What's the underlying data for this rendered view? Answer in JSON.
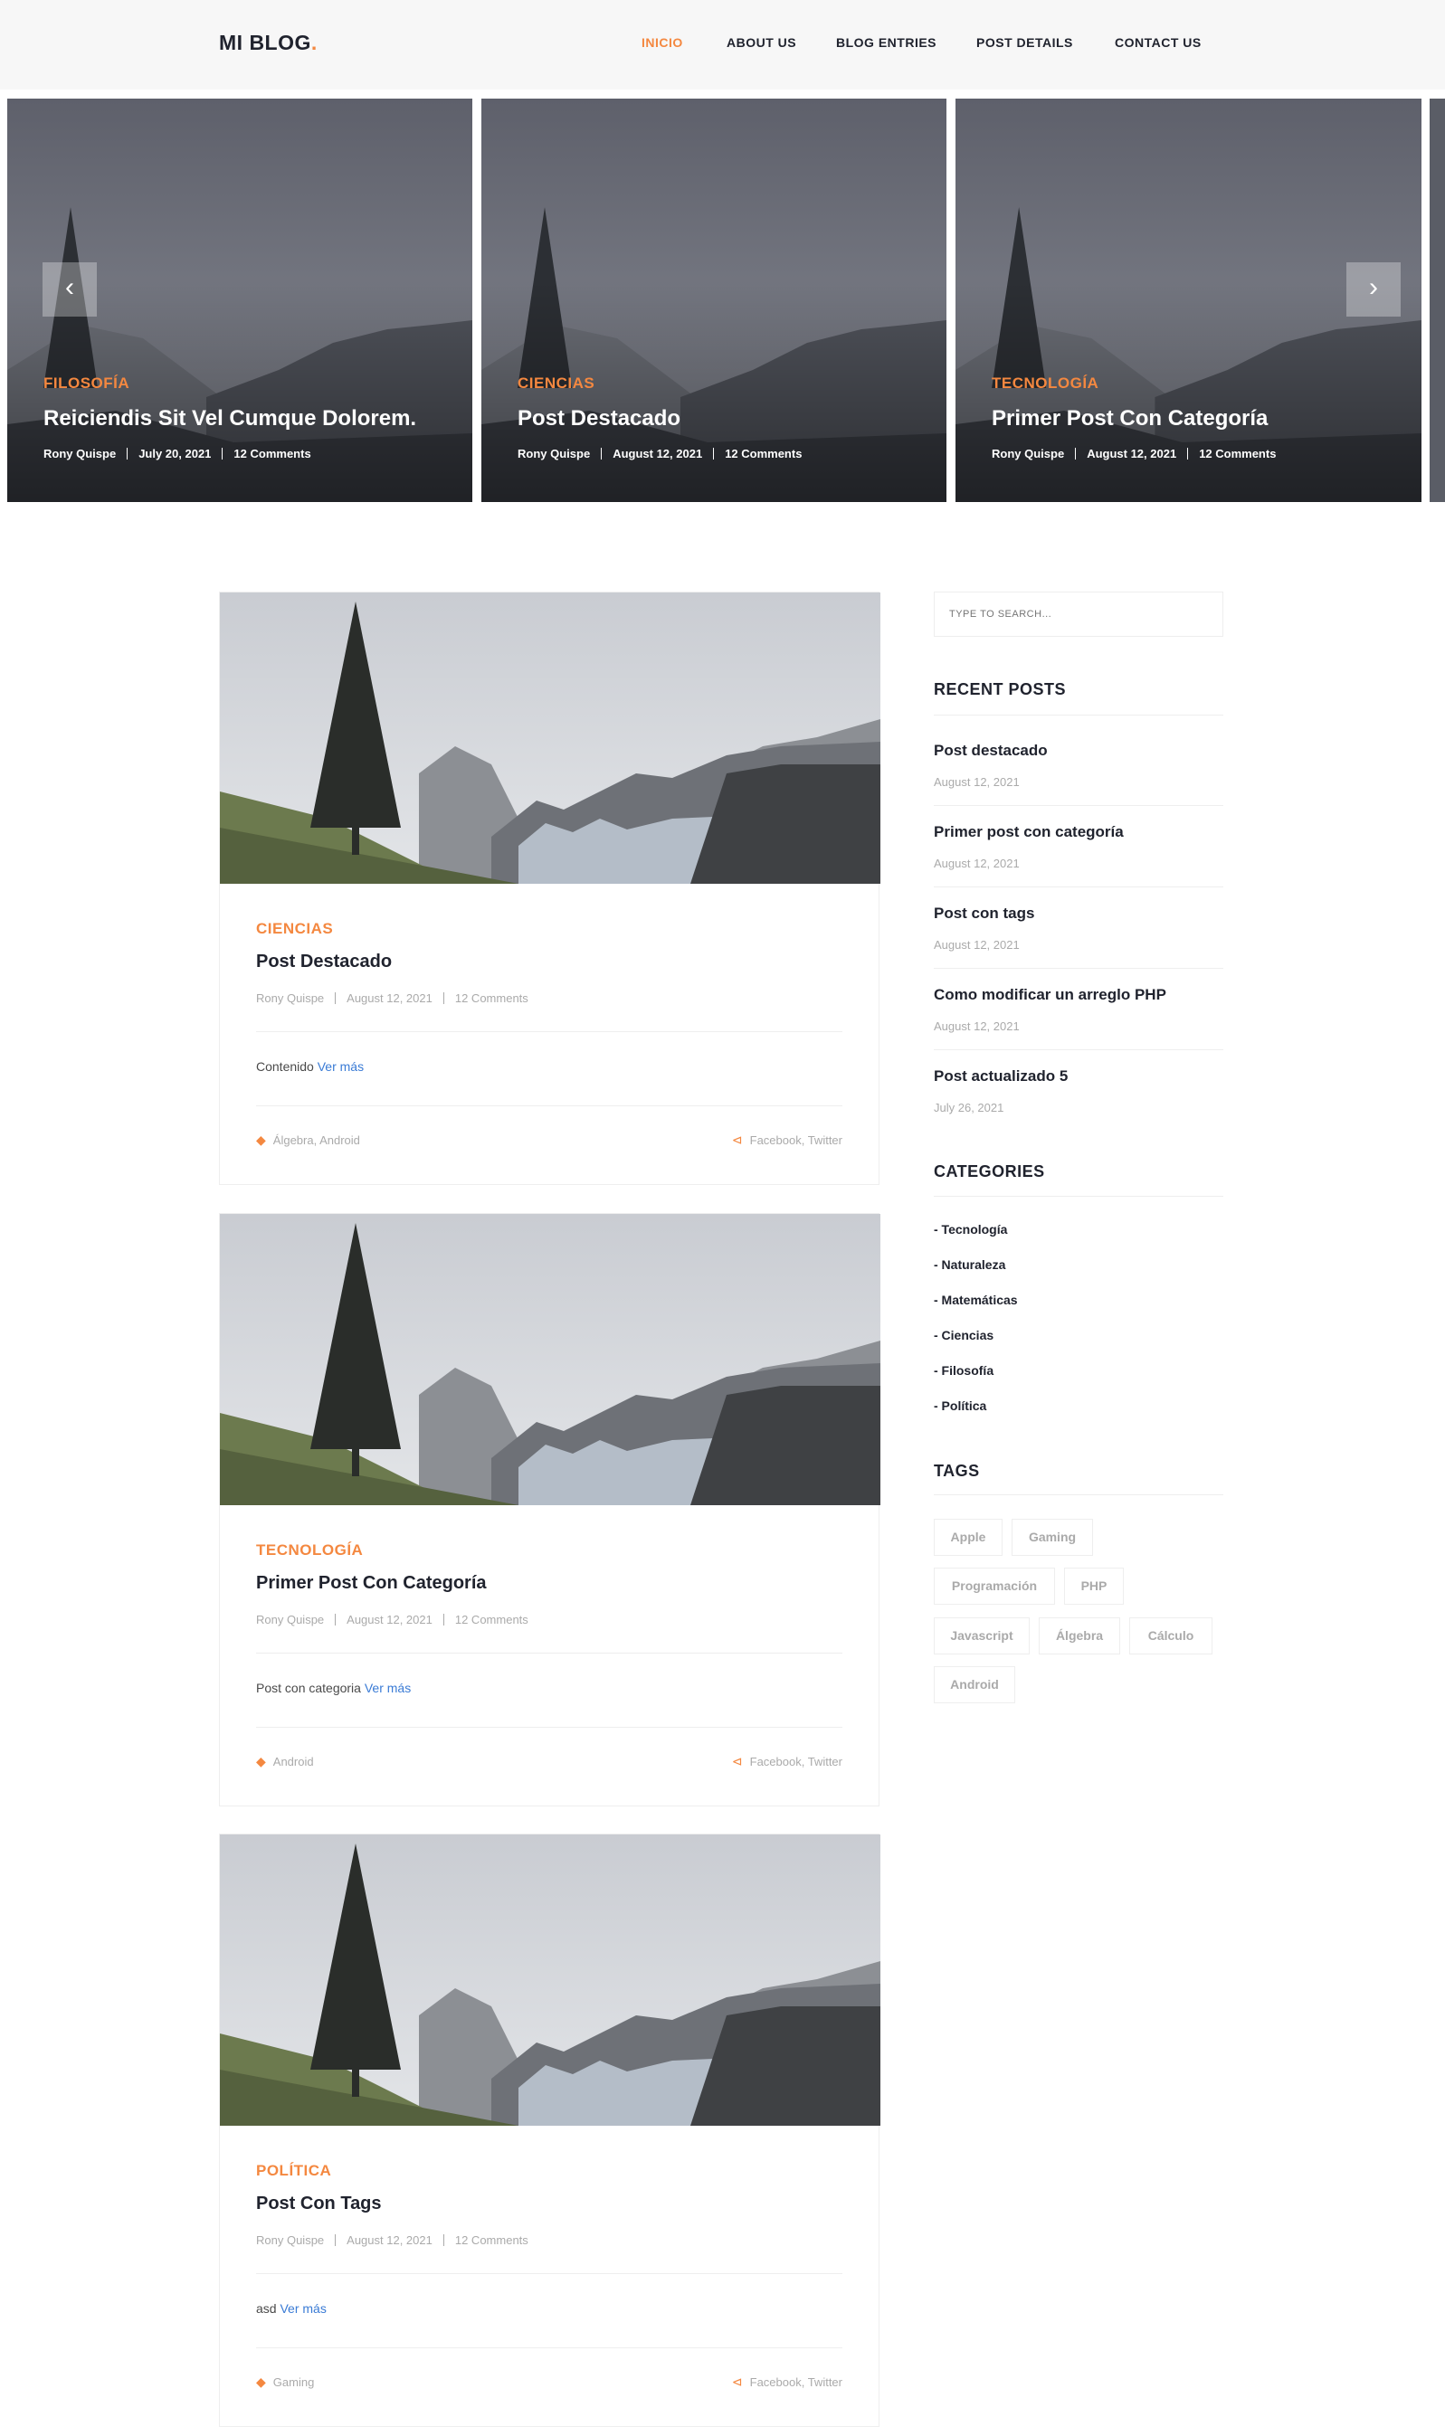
{
  "header": {
    "logo": "MI BLOG",
    "logo_dot": ".",
    "nav": [
      "INICIO",
      "ABOUT US",
      "BLOG ENTRIES",
      "POST DETAILS",
      "CONTACT US"
    ],
    "active": "INICIO"
  },
  "banner": {
    "prev_icon": "‹",
    "next_icon": "›",
    "slides": [
      {
        "category": "FILOSOFÍA",
        "title": "Reiciendis Sit Vel Cumque Dolorem.",
        "author": "Rony Quispe",
        "date": "July 20, 2021",
        "comments": "12 Comments"
      },
      {
        "category": "CIENCIAS",
        "title": "Post Destacado",
        "author": "Rony Quispe",
        "date": "August 12, 2021",
        "comments": "12 Comments"
      },
      {
        "category": "TECNOLOGÍA",
        "title": "Primer Post Con Categoría",
        "author": "Rony Quispe",
        "date": "August 12, 2021",
        "comments": "12 Comments"
      }
    ]
  },
  "posts": [
    {
      "category": "CIENCIAS",
      "title": "Post Destacado",
      "author": "Rony Quispe",
      "date": "August 12, 2021",
      "comments": "12 Comments",
      "excerpt": "Contenido",
      "more": "Ver más",
      "tags": "Álgebra, Android",
      "share": "Facebook, Twitter"
    },
    {
      "category": "TECNOLOGÍA",
      "title": "Primer Post Con Categoría",
      "author": "Rony Quispe",
      "date": "August 12, 2021",
      "comments": "12 Comments",
      "excerpt": "Post con categoria",
      "more": "Ver más",
      "tags": "Android",
      "share": "Facebook, Twitter"
    },
    {
      "category": "POLÍTICA",
      "title": "Post Con Tags",
      "author": "Rony Quispe",
      "date": "August 12, 2021",
      "comments": "12 Comments",
      "excerpt": "asd",
      "more": "Ver más",
      "tags": "Gaming",
      "share": "Facebook, Twitter"
    }
  ],
  "sidebar": {
    "search_placeholder": "TYPE TO SEARCH...",
    "recent_heading": "RECENT POSTS",
    "recent": [
      {
        "title": "Post destacado",
        "date": "August 12, 2021"
      },
      {
        "title": "Primer post con categoría",
        "date": "August 12, 2021"
      },
      {
        "title": "Post con tags",
        "date": "August 12, 2021"
      },
      {
        "title": "Como modificar un arreglo PHP",
        "date": "August 12, 2021"
      },
      {
        "title": "Post actualizado 5",
        "date": "July 26, 2021"
      }
    ],
    "categories_heading": "CATEGORIES",
    "categories": [
      "- Tecnología",
      "- Naturaleza",
      "- Matemáticas",
      "- Ciencias",
      "- Filosofía",
      "- Política"
    ],
    "tags_heading": "TAGS",
    "tags": [
      "Apple",
      "Gaming",
      "Programación",
      "PHP",
      "Javascript",
      "Álgebra",
      "Cálculo",
      "Android"
    ]
  },
  "colors": {
    "accent": "#f48840",
    "link": "#3a7bd5",
    "dark": "#20232e"
  },
  "icons": {
    "tag": "tags-icon",
    "share": "share-icon"
  }
}
